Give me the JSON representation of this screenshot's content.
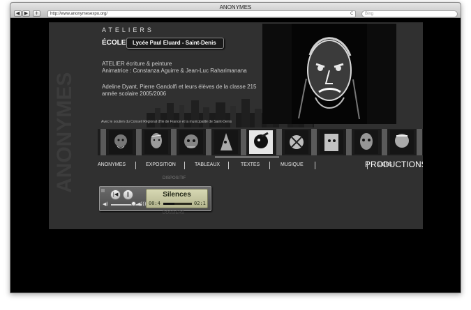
{
  "browser": {
    "title": "ANONYMES",
    "url": "http://www.anonymesexpo.org/",
    "search_placeholder": "Bing",
    "back_icon": "◀",
    "forward_icon": "▶",
    "add_icon": "+",
    "reload_icon": "C"
  },
  "site": {
    "watermark": "ANONYMES",
    "ateliers": "ATELIERS",
    "ecoles_label": "ÉCOLES :",
    "school": "Lycée Paul Eluard - Saint-Denis",
    "atelier_line": "ATELIER écriture & peinture",
    "animatrice_line": "Animatrice : Constanza Aguirre & Jean-Luc Raharimanana",
    "students_line": "Adeline Dyant, Pierre Gandolfi et leurs élèves de la classe 215",
    "year_line": "année scolaire 2005/2006",
    "soutien": "Avec le soutien du Conseil Régional d'Ile de France et la municipalité de Saint-Denis"
  },
  "nav": {
    "items": [
      "ANONYMES",
      "EXPOSITION",
      "TABLEAUX",
      "TEXTES",
      "MUSIQUE",
      "PRODUCTIONS",
      "LIENS"
    ],
    "active": "PRODUCTIONS",
    "sub_item": "DISPOSITIF",
    "sub_item_below": "DOSSIERS"
  },
  "player": {
    "track": "Silences",
    "elapsed": "00:4",
    "total": "02:1",
    "progress": 0.4,
    "volume": 0.78
  },
  "icons": {
    "prev": "|◀",
    "pause": "||",
    "speaker": "◀)",
    "speaker_high": "◀)))"
  }
}
